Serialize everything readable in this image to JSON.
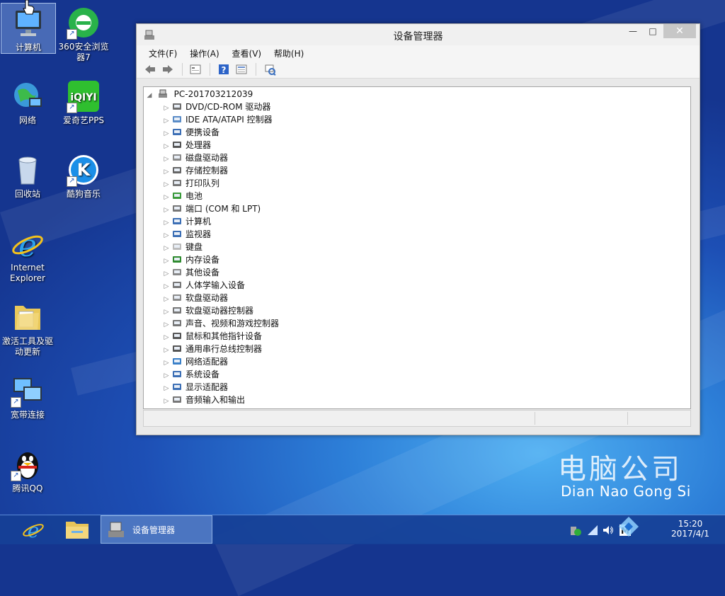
{
  "desktop": {
    "icons": [
      {
        "label": "计算机"
      },
      {
        "label": "360安全浏览器7"
      },
      {
        "label": "网络"
      },
      {
        "label": "爱奇艺PPS"
      },
      {
        "label": "回收站"
      },
      {
        "label": "酷狗音乐"
      },
      {
        "label": "Internet Explorer"
      },
      {
        "label": "激活工具及驱动更新"
      },
      {
        "label": "宽带连接"
      },
      {
        "label": "腾讯QQ"
      }
    ],
    "watermark_line1": "电脑公司",
    "watermark_line2": "Dian Nao Gong Si"
  },
  "window": {
    "title": "设备管理器",
    "controls": {
      "minimize": "—",
      "maximize": "□",
      "close": "✕"
    },
    "menu": [
      "文件(F)",
      "操作(A)",
      "查看(V)",
      "帮助(H)"
    ],
    "toolbar_icons": [
      "back-icon",
      "forward-icon",
      "properties-icon",
      "help-icon",
      "view-icon",
      "scan-hardware-icon"
    ],
    "tree": {
      "root": "PC-201703212039",
      "items": [
        {
          "label": "DVD/CD-ROM 驱动器",
          "icon": "dvd-drive-icon"
        },
        {
          "label": "IDE ATA/ATAPI 控制器",
          "icon": "ide-controller-icon"
        },
        {
          "label": "便携设备",
          "icon": "portable-device-icon"
        },
        {
          "label": "处理器",
          "icon": "processor-icon"
        },
        {
          "label": "磁盘驱动器",
          "icon": "disk-drive-icon"
        },
        {
          "label": "存储控制器",
          "icon": "storage-controller-icon"
        },
        {
          "label": "打印队列",
          "icon": "printer-icon"
        },
        {
          "label": "电池",
          "icon": "battery-icon"
        },
        {
          "label": "端口 (COM 和 LPT)",
          "icon": "port-icon"
        },
        {
          "label": "计算机",
          "icon": "computer-icon"
        },
        {
          "label": "监视器",
          "icon": "monitor-icon"
        },
        {
          "label": "键盘",
          "icon": "keyboard-icon"
        },
        {
          "label": "内存设备",
          "icon": "memory-icon"
        },
        {
          "label": "其他设备",
          "icon": "unknown-device-icon"
        },
        {
          "label": "人体学输入设备",
          "icon": "hid-icon"
        },
        {
          "label": "软盘驱动器",
          "icon": "floppy-drive-icon"
        },
        {
          "label": "软盘驱动器控制器",
          "icon": "floppy-controller-icon"
        },
        {
          "label": "声音、视频和游戏控制器",
          "icon": "sound-icon"
        },
        {
          "label": "鼠标和其他指针设备",
          "icon": "mouse-icon"
        },
        {
          "label": "通用串行总线控制器",
          "icon": "usb-icon"
        },
        {
          "label": "网络适配器",
          "icon": "network-adapter-icon"
        },
        {
          "label": "系统设备",
          "icon": "system-device-icon"
        },
        {
          "label": "显示适配器",
          "icon": "display-adapter-icon"
        },
        {
          "label": "音频输入和输出",
          "icon": "audio-io-icon"
        }
      ]
    }
  },
  "taskbar": {
    "active_task": "设备管理器",
    "clock_time": "15:20",
    "clock_date": "2017/4/1"
  },
  "colors": {
    "accent": "#1d4fb5",
    "close_button": "#c7c7c7"
  }
}
